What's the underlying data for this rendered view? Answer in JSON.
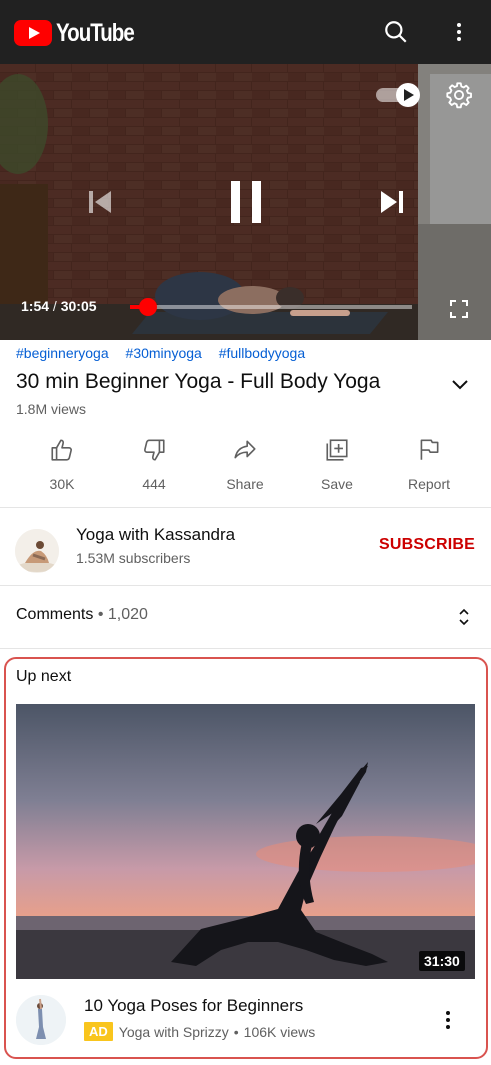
{
  "app": {
    "logo_text": "YouTube"
  },
  "header": {
    "icons": [
      "search-icon",
      "more-vert-icon"
    ]
  },
  "player": {
    "current_time": "1:54",
    "separator": "/",
    "duration": "30:05",
    "progress_fraction": 0.063,
    "autoplay": "on"
  },
  "video": {
    "hashtags": [
      "#beginneryoga",
      "#30minyoga",
      "#fullbodyyoga"
    ],
    "title": "30 min Beginner Yoga - Full Body Yoga",
    "views": "1.8M views"
  },
  "actions": [
    {
      "label": "30K",
      "icon": "thumb-up-icon"
    },
    {
      "label": "444",
      "icon": "thumb-down-icon"
    },
    {
      "label": "Share",
      "icon": "share-icon"
    },
    {
      "label": "Save",
      "icon": "save-playlist-icon"
    },
    {
      "label": "Report",
      "icon": "flag-icon"
    }
  ],
  "channel": {
    "name": "Yoga with Kassandra",
    "subscribers": "1.53M subscribers",
    "subscribe_label": "SUBSCRIBE"
  },
  "comments": {
    "label": "Comments",
    "separator": "•",
    "count": "1,020"
  },
  "up_next": {
    "label": "Up next",
    "duration": "31:30",
    "title": "10 Yoga Poses for Beginners",
    "ad_badge": "AD",
    "channel": "Yoga with Sprizzy",
    "separator": "•",
    "views": "106K views"
  },
  "colors": {
    "brand_red": "#ff0000",
    "link_blue": "#065fd4",
    "subscribe_red": "#cc0000",
    "ad_yellow": "#f9c51d",
    "highlight_border": "#d9534f"
  }
}
